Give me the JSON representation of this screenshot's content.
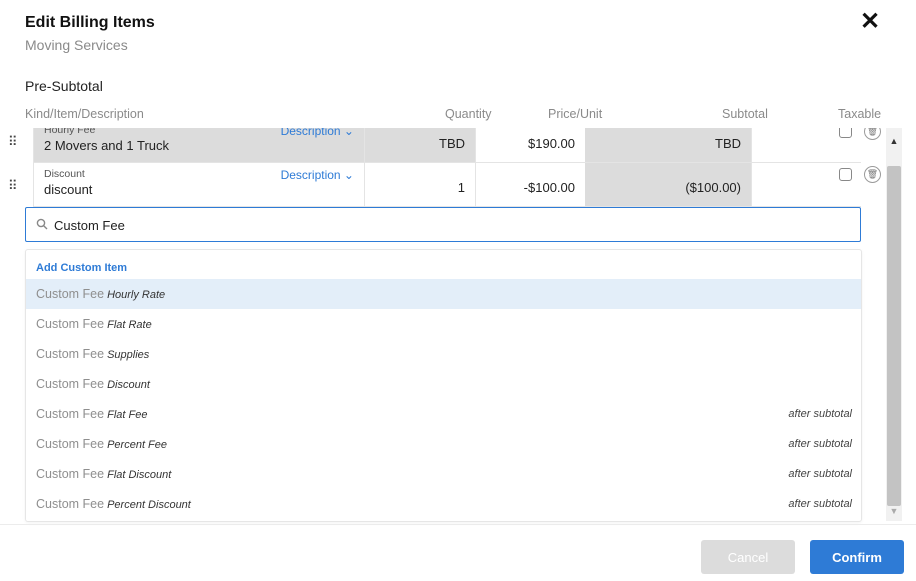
{
  "modal": {
    "title": "Edit Billing Items",
    "subtitle": "Moving Services",
    "close_icon": "✕"
  },
  "section": {
    "title": "Pre-Subtotal"
  },
  "columns": {
    "kind": "Kind/Item/Description",
    "quantity": "Quantity",
    "price": "Price/Unit",
    "subtotal": "Subtotal",
    "taxable": "Taxable"
  },
  "rows": [
    {
      "kind": "Hourly Fee",
      "item": "2 Movers and 1 Truck",
      "description_link": "Description ⌄",
      "quantity": "TBD",
      "price": "$190.00",
      "subtotal": "TBD",
      "taxable": false
    },
    {
      "kind": "Discount",
      "item": "discount",
      "description_link": "Description ⌄",
      "quantity": "1",
      "price": "-$100.00",
      "subtotal": "($100.00)",
      "taxable": false
    }
  ],
  "search": {
    "value": "Custom Fee",
    "icon": "search-icon"
  },
  "dropdown": {
    "header": "Add Custom Item",
    "items": [
      {
        "name": "Custom Fee",
        "type": "Hourly Rate",
        "note": ""
      },
      {
        "name": "Custom Fee",
        "type": "Flat Rate",
        "note": ""
      },
      {
        "name": "Custom Fee",
        "type": "Supplies",
        "note": ""
      },
      {
        "name": "Custom Fee",
        "type": "Discount",
        "note": ""
      },
      {
        "name": "Custom Fee",
        "type": "Flat Fee",
        "note": "after subtotal"
      },
      {
        "name": "Custom Fee",
        "type": "Percent Fee",
        "note": "after subtotal"
      },
      {
        "name": "Custom Fee",
        "type": "Flat Discount",
        "note": "after subtotal"
      },
      {
        "name": "Custom Fee",
        "type": "Percent Discount",
        "note": "after subtotal"
      }
    ],
    "active_index": 0
  },
  "footer": {
    "cancel_label": "Cancel",
    "confirm_label": "Confirm"
  },
  "colors": {
    "accent": "#2e7bd6",
    "highlight": "#e3eef9",
    "disabled": "#dcdcdc"
  }
}
